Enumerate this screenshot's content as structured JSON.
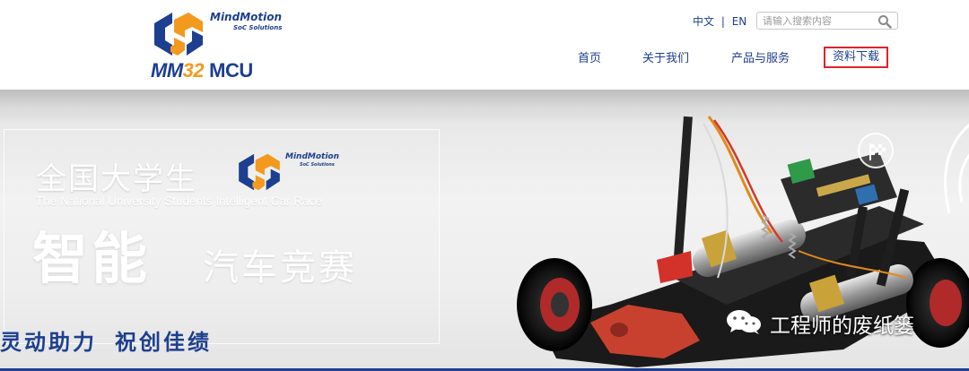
{
  "header": {
    "logo": {
      "brand": "MindMotion",
      "tagline": "SoC Solutions",
      "product_mm": "MM",
      "product_32": "32",
      "product_mcu": "MCU",
      "colors": {
        "blue": "#1d3f8f",
        "orange": "#f39a1e"
      }
    },
    "lang": {
      "zh": "中文",
      "separator": "|",
      "en": "EN"
    },
    "search": {
      "placeholder": "请输入搜索内容",
      "value": "",
      "icon": "search-icon"
    },
    "nav": [
      {
        "label": "首页"
      },
      {
        "label": "关于我们"
      },
      {
        "label": "产品与服务"
      },
      {
        "label": "资料下载",
        "active": true
      }
    ],
    "active_highlight_color": "#e0222a"
  },
  "banner": {
    "title_cn": "全国大学生",
    "logo_brand": "MindMotion",
    "logo_tagline": "SoC Solutions",
    "subtitle_en": "The National University Students Intelligent Car Race",
    "title_big": "智能",
    "title_race": "汽车竞赛",
    "slogan_part1": "灵动助力",
    "slogan_part2": "祝创佳绩",
    "icons": [
      "checkered-flag-icon",
      "smart-car-image"
    ]
  },
  "watermark": {
    "text": "工程师的废纸篓",
    "icon": "wechat-icon"
  }
}
